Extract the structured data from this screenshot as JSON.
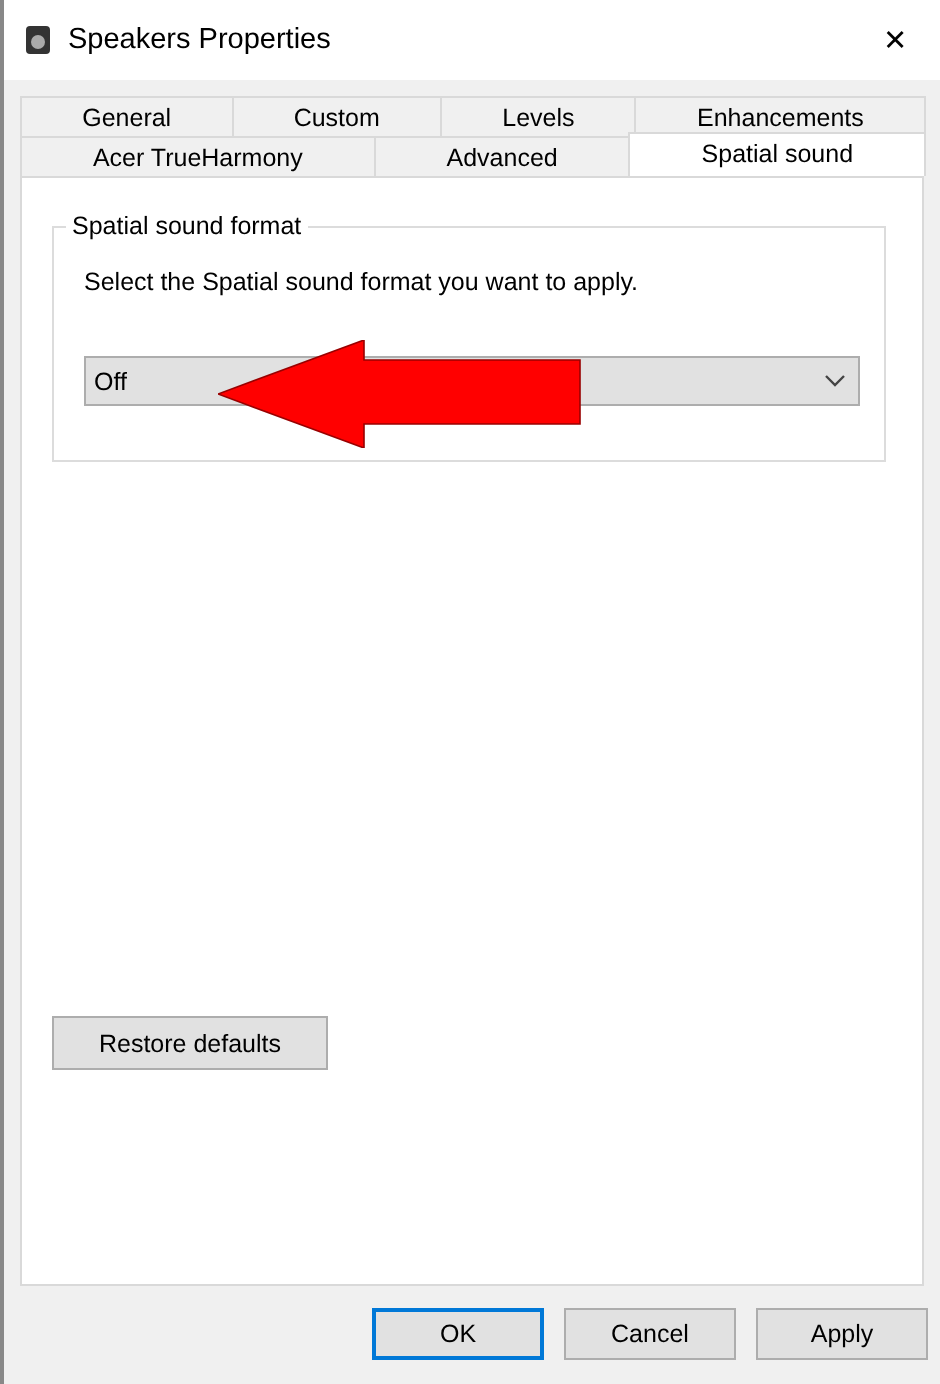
{
  "window": {
    "title": "Speakers Properties",
    "close": "✕"
  },
  "tab_rows": [
    {
      "tabs": [
        {
          "label": "General",
          "selected": false
        },
        {
          "label": "Custom",
          "selected": false
        },
        {
          "label": "Levels",
          "selected": false
        },
        {
          "label": "Enhancements",
          "selected": false
        }
      ]
    },
    {
      "tabs": [
        {
          "label": "Acer TrueHarmony",
          "selected": false
        },
        {
          "label": "Advanced",
          "selected": false
        },
        {
          "label": "Spatial sound",
          "selected": true
        }
      ]
    }
  ],
  "group": {
    "title": "Spatial sound format",
    "instruction": "Select the Spatial sound format you want to apply.",
    "dropdown": {
      "value": "Off"
    }
  },
  "restore_button": "Restore defaults",
  "buttons": [
    {
      "label": "OK",
      "default": true
    },
    {
      "label": "Cancel",
      "default": false
    },
    {
      "label": "Apply",
      "default": false
    }
  ]
}
